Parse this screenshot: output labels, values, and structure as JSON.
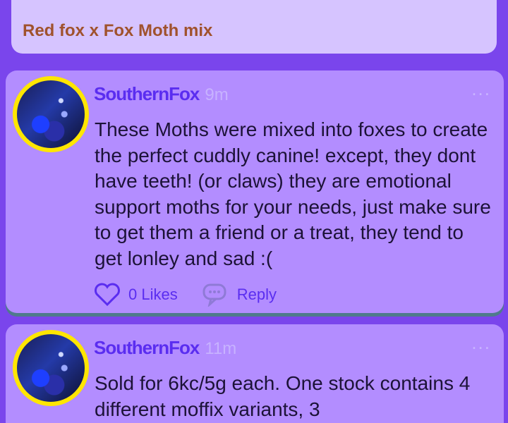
{
  "post": {
    "title": "Red fox x Fox Moth mix"
  },
  "comments": [
    {
      "author": "SouthernFox",
      "time": "9m",
      "more": "...",
      "text": "These Moths were mixed into foxes to create the perfect cuddly canine! except, they dont have teeth! (or claws) they are emotional support moths for your needs, just make sure to get them a friend or a treat, they tend to get lonley and sad :(",
      "likes_label": "0 Likes",
      "reply_label": "Reply"
    },
    {
      "author": "SouthernFox",
      "time": "11m",
      "more": "...",
      "text": "Sold for 6kc/5g each. One stock contains 4 different moffix variants, 3"
    }
  ],
  "colors": {
    "background": "#7a45ec",
    "card": "#b38dff",
    "top_card": "#d6c4ff",
    "author": "#5a2df0",
    "title": "#a0522d",
    "avatar_ring": "#ffe600"
  },
  "icons": [
    "heart-icon",
    "reply-icon",
    "more-options-icon",
    "avatar"
  ]
}
